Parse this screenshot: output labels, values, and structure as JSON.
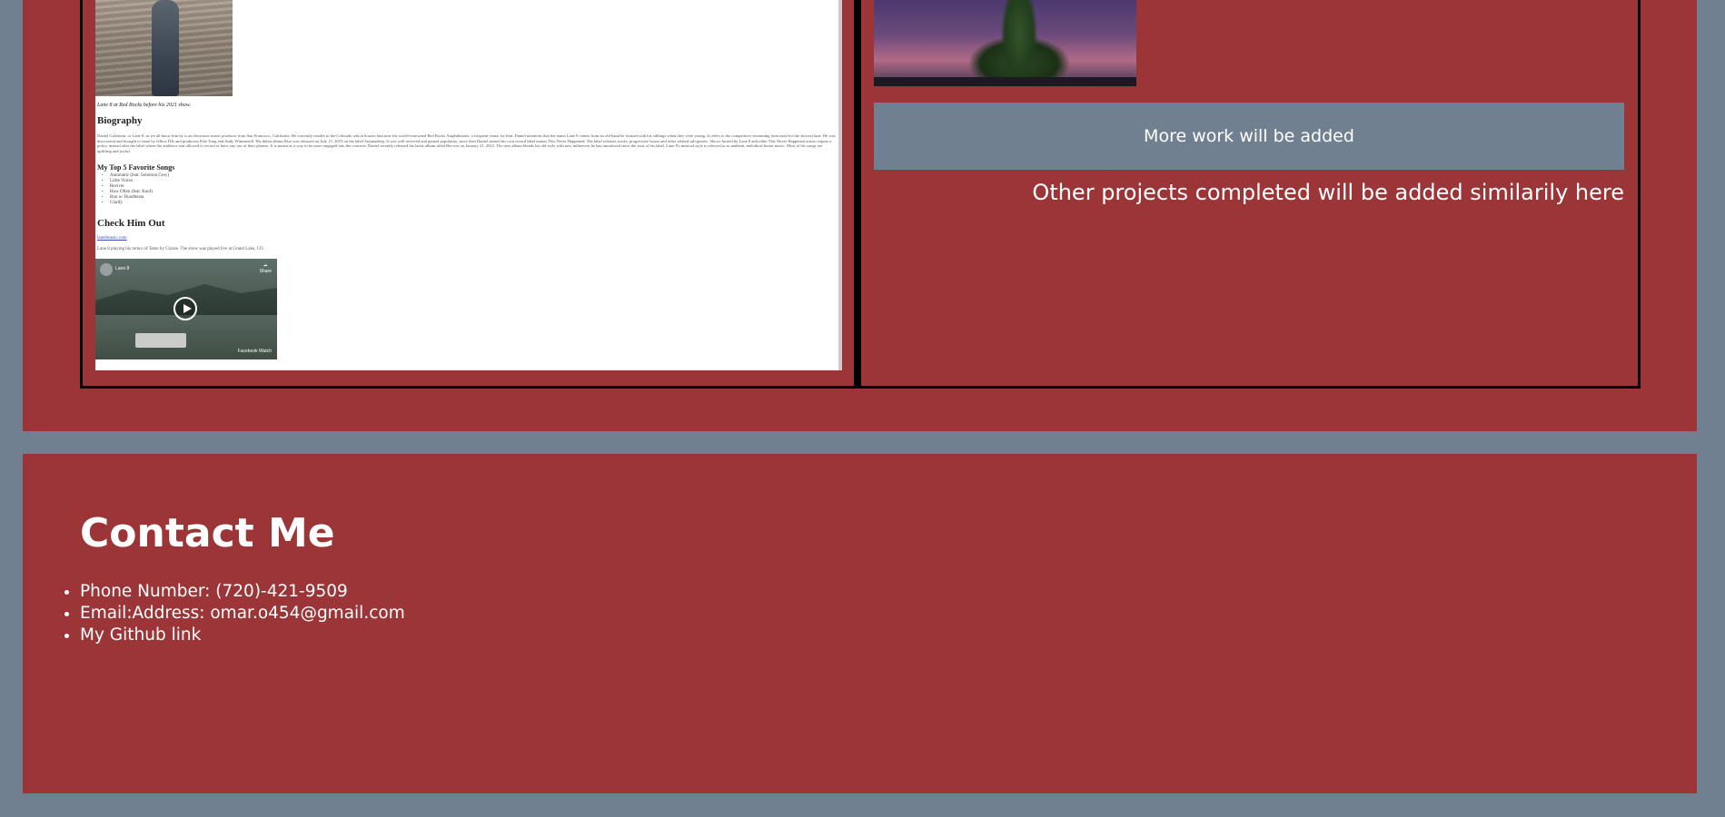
{
  "left_preview": {
    "photo_caption": "Lane 8 at Red Rocks before his 2021 show.",
    "biography_heading": "Biography",
    "biography_text": "Daniel Goldstein, or Lane 8, as we all know him by is an electronic music producer from San Francisco, California. He currently resides in the Colorado which houses him near the world-renowned Red Rocks Amphitheatre, a frequent venue for him. Daniel mentions that the name Lane 8 comes from an old band he formed with his siblings when they were young. It refers to the competitive swimming term used for the slowest lane. He was discovered and brought to fame by fellow DJs and producers Pete Tong and Andy Wimmerell. His debut album Rise was released on July 15, 2015 on the label Anjunadeep. It was well received and gained popularity, since then Daniel started his own record label names This Never Happened. The label releases tracks, progressive house and other related sub-genres. Shows hosted by Lane 8 and other This Never Happened artists require a policy instead after the label where the audience isnt allowed to record or have any use of their phones. It is meant as a way to be more engaged into the concerts. Daniel recently released his latest album titled Reviver on January 21, 2022. The new album blends his old style with new influences he has introduced since the start of his label. Lane 8's musical style is referred to as ambient, melodical house music. Most of his songs are uplifting and joyful.",
    "songs_heading": "My Top 5 Favorite Songs",
    "songs": [
      "Automatic (feat. Solomon Grey)",
      "Little Voices",
      "Reviver",
      "How Often (feat. Kauf)",
      "Run w/ Ruudbeata",
      "Clarify"
    ],
    "check_heading": "Check Him Out",
    "site_link": "lane8music.com",
    "video_caption": "Lane 8 playing his remix of Tame by Clozee. The show was played live at Grand Lake, CO.",
    "video_channel": "Lane 8",
    "video_share": "Share",
    "video_watch": "Facebook Watch"
  },
  "right_column": {
    "more_work_label": "More work will be added",
    "other_projects_text": "Other projects completed will be added similarily here"
  },
  "contact": {
    "title": "Contact Me",
    "items": [
      "Phone Number: (720)-421-9509",
      "Email:Address: omar.o454@gmail.com",
      "My Github link"
    ]
  },
  "colors": {
    "page_background": "#708090",
    "panel": "#9b3537",
    "button": "#708090",
    "text": "#ffffff"
  }
}
